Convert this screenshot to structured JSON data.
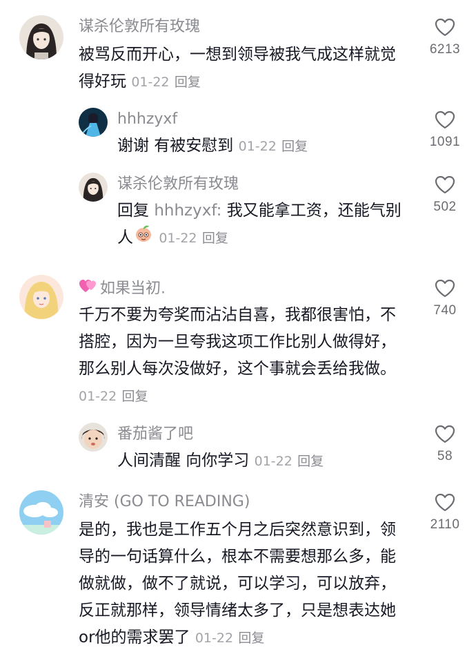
{
  "colors": {
    "text": "#161823",
    "username": "#8a8b91",
    "meta": "#a2a3a8",
    "like_icon": "#6b6c72"
  },
  "comments": [
    {
      "username": "谋杀伦敦所有玫瑰",
      "text": "被骂反而开心，一想到领导被我气成这样就觉得好玩",
      "date": "01-22",
      "reply": "回复",
      "likes": "6213",
      "replies": [
        {
          "username": "hhhzyxf",
          "text": "谢谢 有被安慰到",
          "date": "01-22",
          "reply": "回复",
          "likes": "1091"
        },
        {
          "username": "谋杀伦敦所有玫瑰",
          "reply_prefix": "回复",
          "mention": "hhhzyxf:",
          "text": "我又能拿工资，还能气别人",
          "emoji": "peach-face-emoji",
          "date": "01-22",
          "reply": "回复",
          "likes": "502"
        }
      ]
    },
    {
      "username": "如果当初.",
      "username_badge": "pink-heart-icon",
      "text": "千万不要为夸奖而沾沾自喜，我都很害怕，不搭腔，因为一旦夸我这项工作比别人做得好，那么别人每次没做好，这个事就会丢给我做。",
      "date": "01-22",
      "reply": "回复",
      "likes": "740",
      "replies": [
        {
          "username": "番茄酱了吧",
          "text": "人间清醒 向你学习",
          "date": "01-22",
          "reply": "回复",
          "likes": "58"
        }
      ]
    },
    {
      "username": "清安 (GO TO READING)",
      "text": "是的，我也是工作五个月之后突然意识到，领导的一句话算什么，根本不需要想那么多，能做就做，做不了就说，可以学习，可以放弃，反正就那样，领导情绪太多了，只是想表达她or他的需求罢了",
      "date": "01-22",
      "reply": "回复",
      "likes": "2110"
    }
  ]
}
